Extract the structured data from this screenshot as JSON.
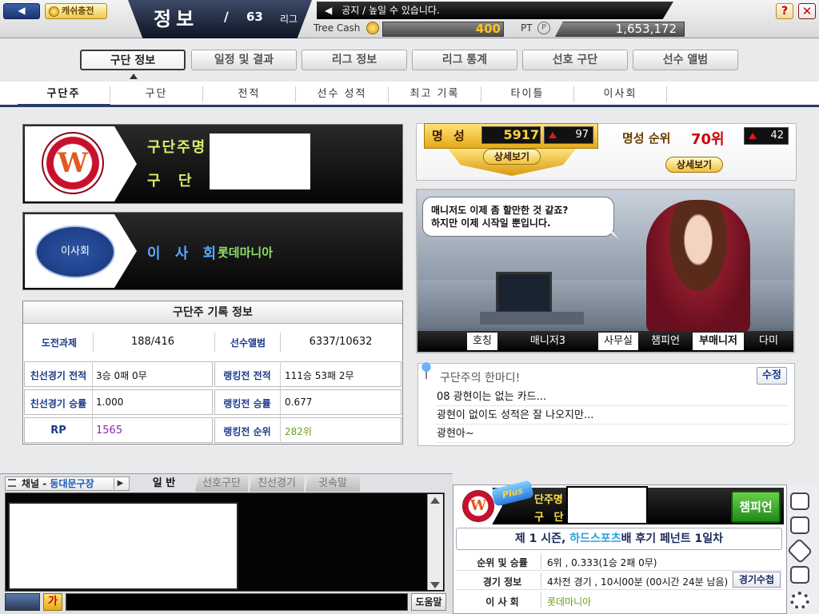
{
  "topbar": {
    "back_arrow": "◀",
    "cash_charge": "캐쉬충전",
    "title": "정보",
    "slash": "/",
    "league_num": "63",
    "league_label": "리그",
    "notice": "공지 / 높일 수 있습니다.",
    "tree_cash_label": "Tree Cash",
    "tree_cash_value": "400",
    "pt_label": "PT",
    "pt_icon": "P",
    "pt_value": "1,653,172",
    "help": "?",
    "close": "✕"
  },
  "main_tabs": [
    "구단 정보",
    "일정 및 결과",
    "리그 정보",
    "리그 통계",
    "선호 구단",
    "선수 앨범"
  ],
  "main_tab_active": 0,
  "sub_tabs": [
    "구단주",
    "구단",
    "전적",
    "선수 성적",
    "최고 기록",
    "타이틀",
    "이사회"
  ],
  "owner_card": {
    "logo_letter": "W",
    "owner_name_label": "구단주명",
    "team_name_label": "구 단 명"
  },
  "board_card": {
    "logo_text": "이사회",
    "label": "이 사 회",
    "value": "롯데마니아"
  },
  "record": {
    "title": "구단주 기록 정보",
    "challenge_label": "도전과제",
    "challenge_value": "188/416",
    "album_label": "선수앨범",
    "album_value": "6337/10632",
    "rows": [
      {
        "l1": "친선경기 전적",
        "v1": "3승 0패 0무",
        "l2": "랭킹전 전적",
        "v2": "111승 53패 2무"
      },
      {
        "l1": "친선경기 승률",
        "v1": "1.000",
        "l2": "랭킹전 승률",
        "v2": "0.677"
      },
      {
        "l1": "RP",
        "v1": "1565",
        "l2": "랭킹전 순위",
        "v2": "282위"
      }
    ]
  },
  "fame": {
    "label": "명 성",
    "value": "5917",
    "delta": "97",
    "detail": "상세보기",
    "rank_label": "명성 순위",
    "rank_value": "70위",
    "rank_delta": "42",
    "rank_detail": "상세보기"
  },
  "scene": {
    "speech_line1": "매니저도 이제 좀 할만한 것 같죠?",
    "speech_line2": "하지만 이제 시작일 뿐입니다.",
    "roles": [
      "호칭",
      "매니저3",
      "사무실",
      "챔피언",
      "부매니저",
      "다미"
    ]
  },
  "message": {
    "title": "구단주의 한마디!",
    "edit": "수정",
    "lines": [
      "08 광현이는 없는 카드...",
      "광현이 없이도 성적은 잘 나오지만...",
      "광현아~"
    ]
  },
  "chat": {
    "channel_label": "채널 - ",
    "channel_value": "동대문구장",
    "play": "▶",
    "tabs": [
      "일 반",
      "선호구단",
      "친선경기",
      "귓속말"
    ],
    "font_btn": "가",
    "help_btn": "도움말"
  },
  "info": {
    "plus_badge": "Plus",
    "owner_label": "단주명",
    "team_label": "구 단 명",
    "champion": "챔피언",
    "season_prefix": "제 1 시즌, ",
    "season_highlight": "하드스포츠",
    "season_suffix": "배 후기 페넌트 1일차",
    "rank_label": "순위 및 승률",
    "rank_value": "6위 , 0.333(1승 2패 0무)",
    "match_label": "경기 정보",
    "match_value": "4차전 경기 , 10시00분 (00시간 24분 남음)",
    "match_btn": "경기수첩",
    "board_label": "이 사 회",
    "board_value": "롯데마니아"
  },
  "colors": {
    "accent_navy": "#2a3a6a",
    "fame_gold": "#e5a914",
    "rp_purple": "#8a2ab4",
    "rank_green": "#6aa01a",
    "board_green": "#8fe06a"
  }
}
